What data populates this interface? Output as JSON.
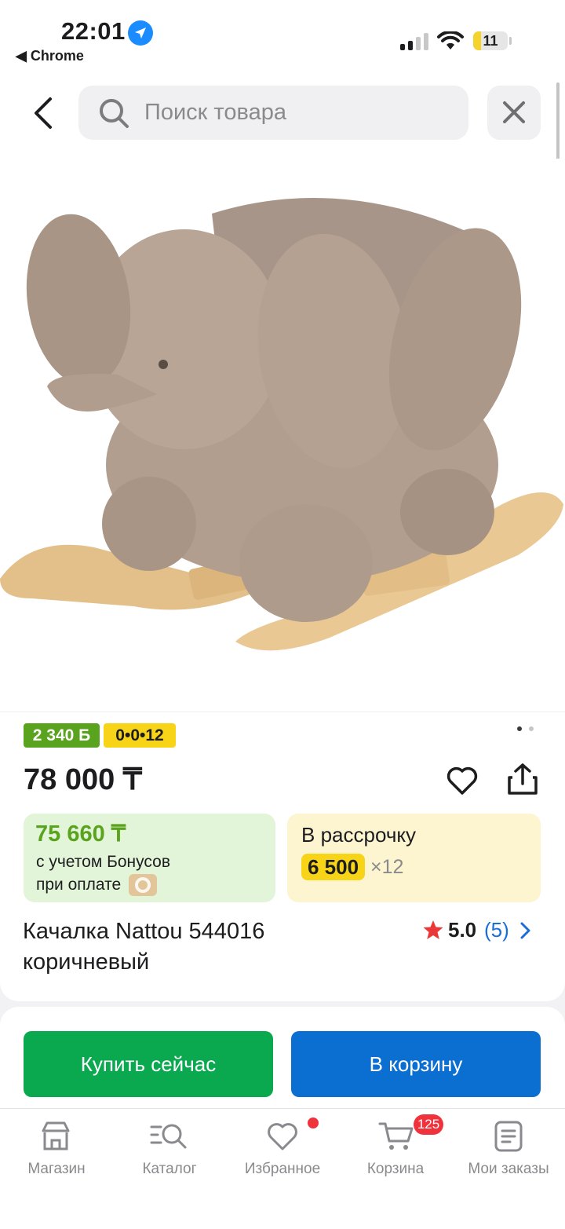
{
  "status_bar": {
    "time": "22:01",
    "back_app": "◀ Chrome",
    "battery": "11"
  },
  "search": {
    "placeholder": "Поиск товара"
  },
  "product": {
    "bonus_badge": "2 340 Б",
    "installment_badge": "0•0•12",
    "price": "78 000 ₸",
    "bonus_price": "75 660 ₸",
    "bonus_note_line1": "с учетом Бонусов",
    "bonus_note_line2": "при оплате",
    "installment_title": "В рассрочку",
    "installment_amount": "6 500",
    "installment_months": "×12",
    "title_line1": "Качалка Nattou 544016",
    "title_line2": "коричневый",
    "rating": "5.0",
    "reviews": "(5)",
    "image_slides": {
      "current": 1,
      "total": 2
    }
  },
  "actions": {
    "buy_now": "Купить сейчас",
    "add_to_cart": "В корзину"
  },
  "tabbar": {
    "shop": "Магазин",
    "catalog": "Каталог",
    "favorites": "Избранное",
    "cart": "Корзина",
    "orders": "Мои заказы",
    "cart_count": "125"
  },
  "colors": {
    "green_cta": "#0aa84f",
    "blue_cta": "#0b6fd1",
    "bonus_green": "#5aa31e",
    "installment_yellow": "#f7d417",
    "notification_red": "#f0323c",
    "rating_star": "#ea3838"
  }
}
